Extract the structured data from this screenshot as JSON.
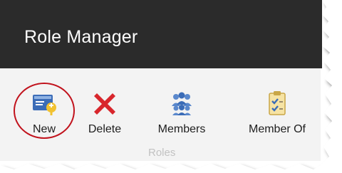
{
  "window": {
    "title": "Role Manager"
  },
  "ribbon": {
    "buttons": [
      {
        "label": "New",
        "icon": "new-role-icon"
      },
      {
        "label": "Delete",
        "icon": "delete-icon"
      },
      {
        "label": "Members",
        "icon": "members-icon"
      },
      {
        "label": "Member Of",
        "icon": "member-of-icon"
      }
    ],
    "group_label": "Roles"
  },
  "colors": {
    "titlebar": "#2b2b2b",
    "ribbon": "#f3f3f3",
    "highlight": "#c1121c",
    "delete_red": "#d8262c",
    "icon_blue": "#3b6cb7"
  }
}
